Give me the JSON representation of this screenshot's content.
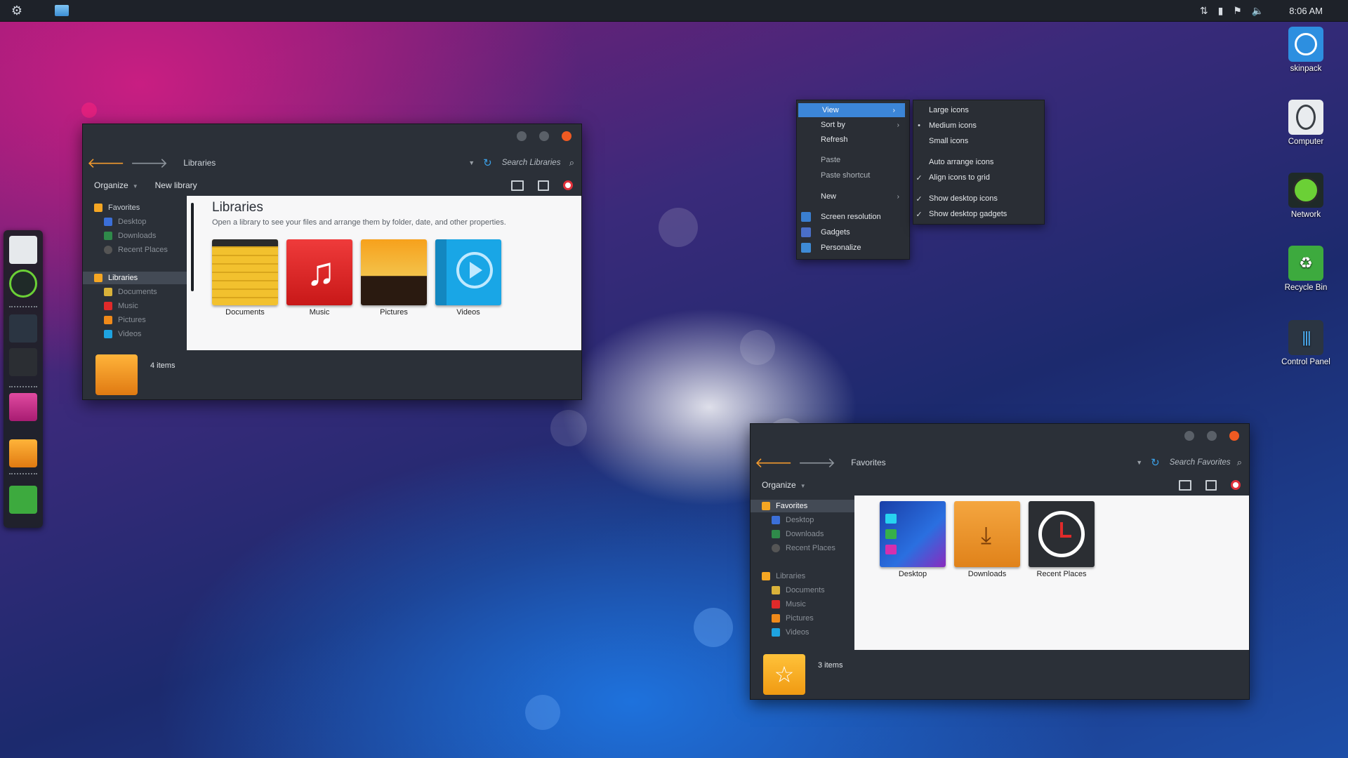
{
  "taskbar": {
    "start_icon": "gear-start-icon",
    "clock": "8:06 AM",
    "tray_icons": [
      "network-arrows-icon",
      "battery-icon",
      "flag-icon",
      "volume-icon"
    ]
  },
  "desktop_icons": [
    {
      "label": "skinpack",
      "icon": "skinpack-icon"
    },
    {
      "label": "Computer",
      "icon": "computer-icon"
    },
    {
      "label": "Network",
      "icon": "network-globe-icon"
    },
    {
      "label": "Recycle Bin",
      "icon": "recycle-bin-icon"
    },
    {
      "label": "Control Panel",
      "icon": "control-panel-icon"
    }
  ],
  "context_menu": {
    "items": [
      {
        "label": "View",
        "highlighted": true,
        "has_submenu": true
      },
      {
        "label": "Sort by",
        "has_submenu": true
      },
      {
        "label": "Refresh"
      },
      {
        "label": "Paste",
        "disabled": true
      },
      {
        "label": "Paste shortcut",
        "disabled": true
      },
      {
        "label": "New",
        "has_submenu": true
      },
      {
        "label": "Screen resolution",
        "icon": "screen-resolution-icon"
      },
      {
        "label": "Gadgets",
        "icon": "gadgets-icon"
      },
      {
        "label": "Personalize",
        "icon": "personalize-icon"
      }
    ],
    "view_submenu": [
      {
        "label": "Large icons"
      },
      {
        "label": "Medium icons",
        "mark": "•"
      },
      {
        "label": "Small icons"
      },
      {
        "label": "Auto arrange icons"
      },
      {
        "label": "Align icons to grid",
        "mark": "✓"
      },
      {
        "label": "Show desktop icons",
        "mark": "✓"
      },
      {
        "label": "Show desktop gadgets",
        "mark": "✓"
      }
    ]
  },
  "window_libraries": {
    "path": "Libraries",
    "search_placeholder": "Search Libraries",
    "toolbar": {
      "organize": "Organize",
      "new_library": "New library"
    },
    "nav": {
      "favorites": "Favorites",
      "favorites_items": [
        "Desktop",
        "Downloads",
        "Recent Places"
      ],
      "libraries": "Libraries",
      "libraries_items": [
        "Documents",
        "Music",
        "Pictures",
        "Videos"
      ]
    },
    "content_title": "Libraries",
    "content_subtitle": "Open a library to see your files and arrange them by folder, date, and other properties.",
    "tiles": [
      "Documents",
      "Music",
      "Pictures",
      "Videos"
    ],
    "status": "4 items"
  },
  "window_favorites": {
    "path": "Favorites",
    "search_placeholder": "Search Favorites",
    "toolbar": {
      "organize": "Organize"
    },
    "nav": {
      "favorites": "Favorites",
      "favorites_items": [
        "Desktop",
        "Downloads",
        "Recent Places"
      ],
      "libraries": "Libraries",
      "libraries_items": [
        "Documents",
        "Music",
        "Pictures",
        "Videos"
      ]
    },
    "tiles": [
      "Desktop",
      "Downloads",
      "Recent Places"
    ],
    "status": "3 items"
  },
  "colors": {
    "accent": "#3c86d8",
    "back_arrow": "#f29a2e",
    "close_button": "#f05a22"
  }
}
